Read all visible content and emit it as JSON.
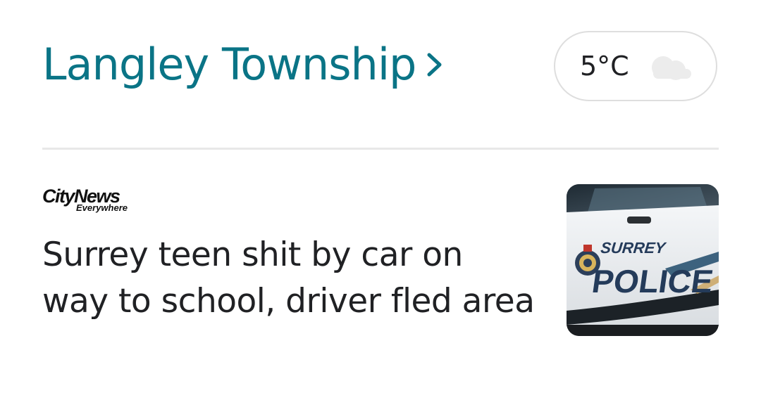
{
  "header": {
    "location_title": "Langley Township",
    "weather": {
      "temperature": "5°C",
      "condition_icon": "cloud-icon"
    }
  },
  "story": {
    "source": {
      "logo_main": "CityNews",
      "logo_sub": "Everywhere"
    },
    "headline": "Surrey teen shit by car on way to school, driver fled area",
    "thumbnail": {
      "door_text_top": "SURREY",
      "door_text_bottom": "POLICE"
    }
  },
  "colors": {
    "link": "#0a7486",
    "text": "#202124",
    "divider": "#e8e8e8",
    "chip_border": "#dedede"
  }
}
